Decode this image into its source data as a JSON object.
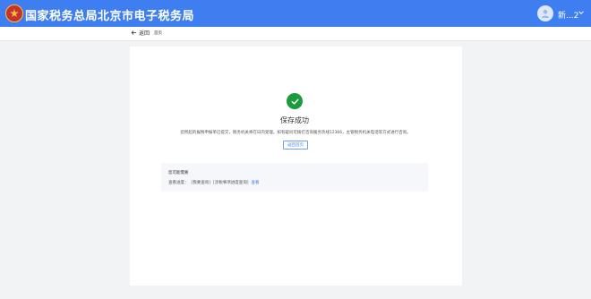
{
  "header": {
    "site_title": "国家税务总局北京市电子税务局",
    "user_name": "新...2",
    "emblem_icon": "national-tax-emblem",
    "avatar_icon": "user-avatar-icon",
    "dropdown_icon": "chevron-down-icon",
    "bar_color": "#3f7ef0"
  },
  "subbar": {
    "back_label": "返回",
    "back_icon": "arrow-left-icon",
    "breadcrumb": "首页"
  },
  "result": {
    "status_icon": "success-check-icon",
    "status_color": "#1a9b3e",
    "title": "保存成功",
    "description": "您所起的报税申报单已提交，税务机关将在日内受理。如有疑问可拨打咨询服务热线12366，主管税务机关电话等方式进行咨询。",
    "home_button": "返回首页"
  },
  "needs": {
    "title": "您可能需要",
    "prefix": "查看进度：",
    "item1": "[我要查询]",
    "item2": "[涉税事项进度查询]",
    "link": "查看"
  }
}
